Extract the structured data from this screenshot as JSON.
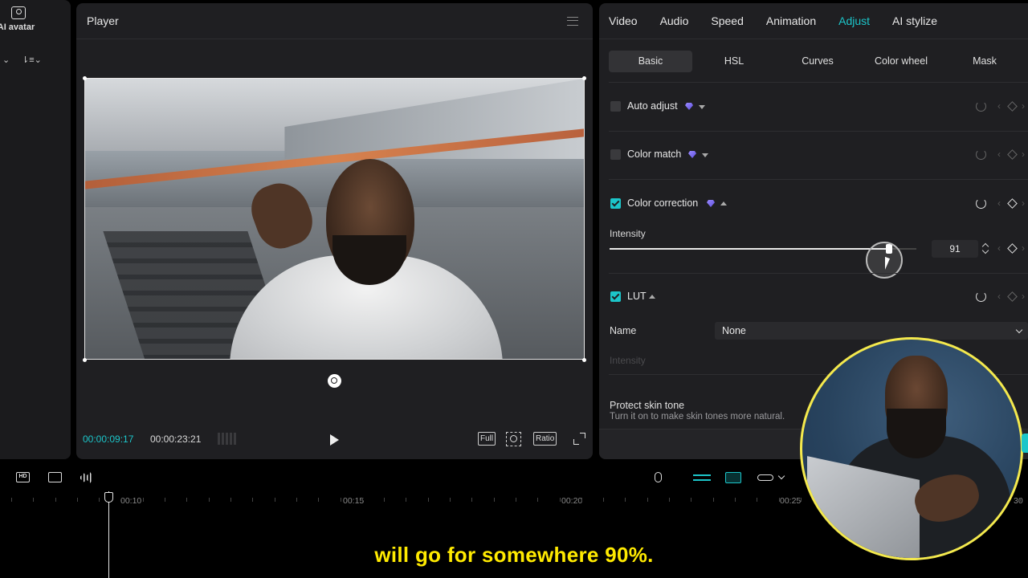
{
  "left_panel": {
    "ai_avatar_label": "AI avatar"
  },
  "player": {
    "title": "Player",
    "current_time": "00:00:09:17",
    "total_time": "00:00:23:21",
    "full_label": "Full",
    "ratio_label": "Ratio"
  },
  "tabs": [
    "Video",
    "Audio",
    "Speed",
    "Animation",
    "Adjust",
    "AI stylize"
  ],
  "active_tab": "Adjust",
  "subtabs": [
    "Basic",
    "HSL",
    "Curves",
    "Color wheel",
    "Mask"
  ],
  "active_subtab": "Basic",
  "adjust": {
    "auto_adjust": {
      "label": "Auto adjust",
      "checked": false
    },
    "color_match": {
      "label": "Color match",
      "checked": false
    },
    "color_correction": {
      "label": "Color correction",
      "checked": true
    },
    "intensity": {
      "label": "Intensity",
      "value": "91",
      "fraction": 0.91
    },
    "lut": {
      "label": "LUT",
      "checked": true
    },
    "name_label": "Name",
    "name_value": "None",
    "lut_intensity_label": "Intensity",
    "protect_skin": {
      "title": "Protect skin tone",
      "description": "Turn it on to make skin tones more natural."
    }
  },
  "timeline": {
    "ticks": [
      "00:10",
      "00:15",
      "00:20",
      "00:25",
      "30"
    ],
    "hd_label": "HD"
  },
  "subtitle": "will go for somewhere 90%.",
  "colors": {
    "accent": "#1cc5c9",
    "subtitle": "#ffea00",
    "webcam_border": "#f4e94d"
  }
}
